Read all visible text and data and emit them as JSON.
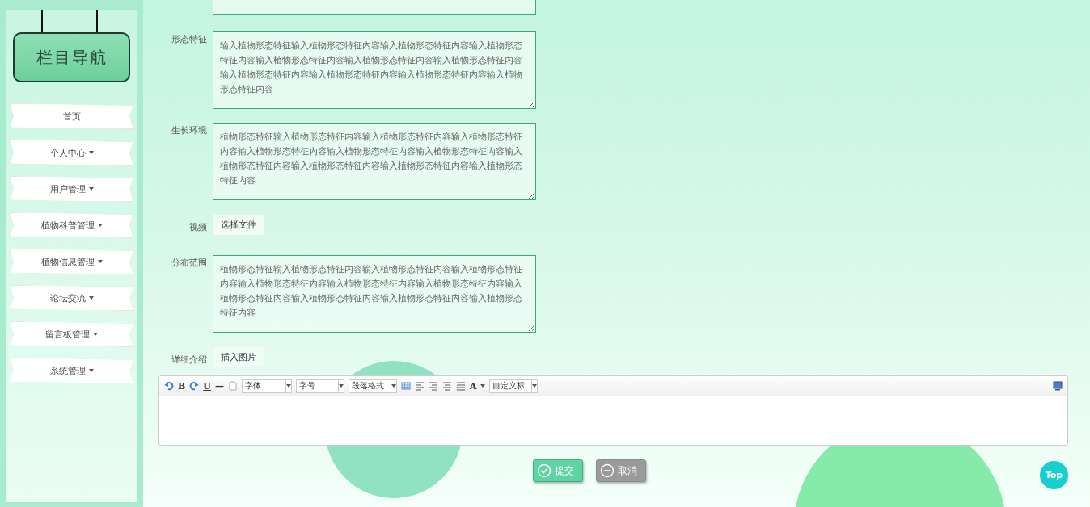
{
  "sidebar": {
    "title": "栏目导航",
    "items": [
      {
        "label": "首页",
        "has_menu": false
      },
      {
        "label": "个人中心",
        "has_menu": true
      },
      {
        "label": "用户管理",
        "has_menu": true
      },
      {
        "label": "植物科普管理",
        "has_menu": true
      },
      {
        "label": "植物信息管理",
        "has_menu": true
      },
      {
        "label": "论坛交流",
        "has_menu": true
      },
      {
        "label": "留言板管理",
        "has_menu": true
      },
      {
        "label": "系统管理",
        "has_menu": true
      }
    ]
  },
  "form": {
    "fields": [
      {
        "kind": "textarea",
        "label": "形态特征",
        "value": "输入植物形态特征输入植物形态特征内容输入植物形态特征内容输入植物形态特征内容输入植物形态特征内容输入植物形态特征内容输入植物形态特征内容输入植物形态特征内容输入植物形态特征内容输入植物形态特征内容输入植物形态特征内容"
      },
      {
        "kind": "textarea",
        "label": "生长环境",
        "value": "植物形态特征输入植物形态特征内容输入植物形态特征内容输入植物形态特征内容输入植物形态特征内容输入植物形态特征内容输入植物形态特征内容输入植物形态特征内容输入植物形态特征内容输入植物形态特征内容输入植物形态特征内容"
      },
      {
        "kind": "file",
        "label": "视频",
        "button": "选择文件"
      },
      {
        "kind": "textarea",
        "label": "分布范围",
        "value": "植物形态特征输入植物形态特征内容输入植物形态特征内容输入植物形态特征内容输入植物形态特征内容输入植物形态特征内容输入植物形态特征内容输入植物形态特征内容输入植物形态特征内容输入植物形态特征内容输入植物形态特征内容"
      },
      {
        "kind": "file",
        "label": "详细介绍",
        "button": "插入图片"
      }
    ],
    "editor": {
      "bold": "B",
      "underline": "U",
      "rule": "—",
      "font_letter": "A",
      "selects": [
        "字体",
        "字号",
        "段落格式"
      ],
      "heading_select": "自定义标"
    },
    "buttons": [
      {
        "kind": "submit",
        "label": "提交"
      },
      {
        "kind": "cancel",
        "label": "取消"
      }
    ]
  },
  "top_button": "Top"
}
